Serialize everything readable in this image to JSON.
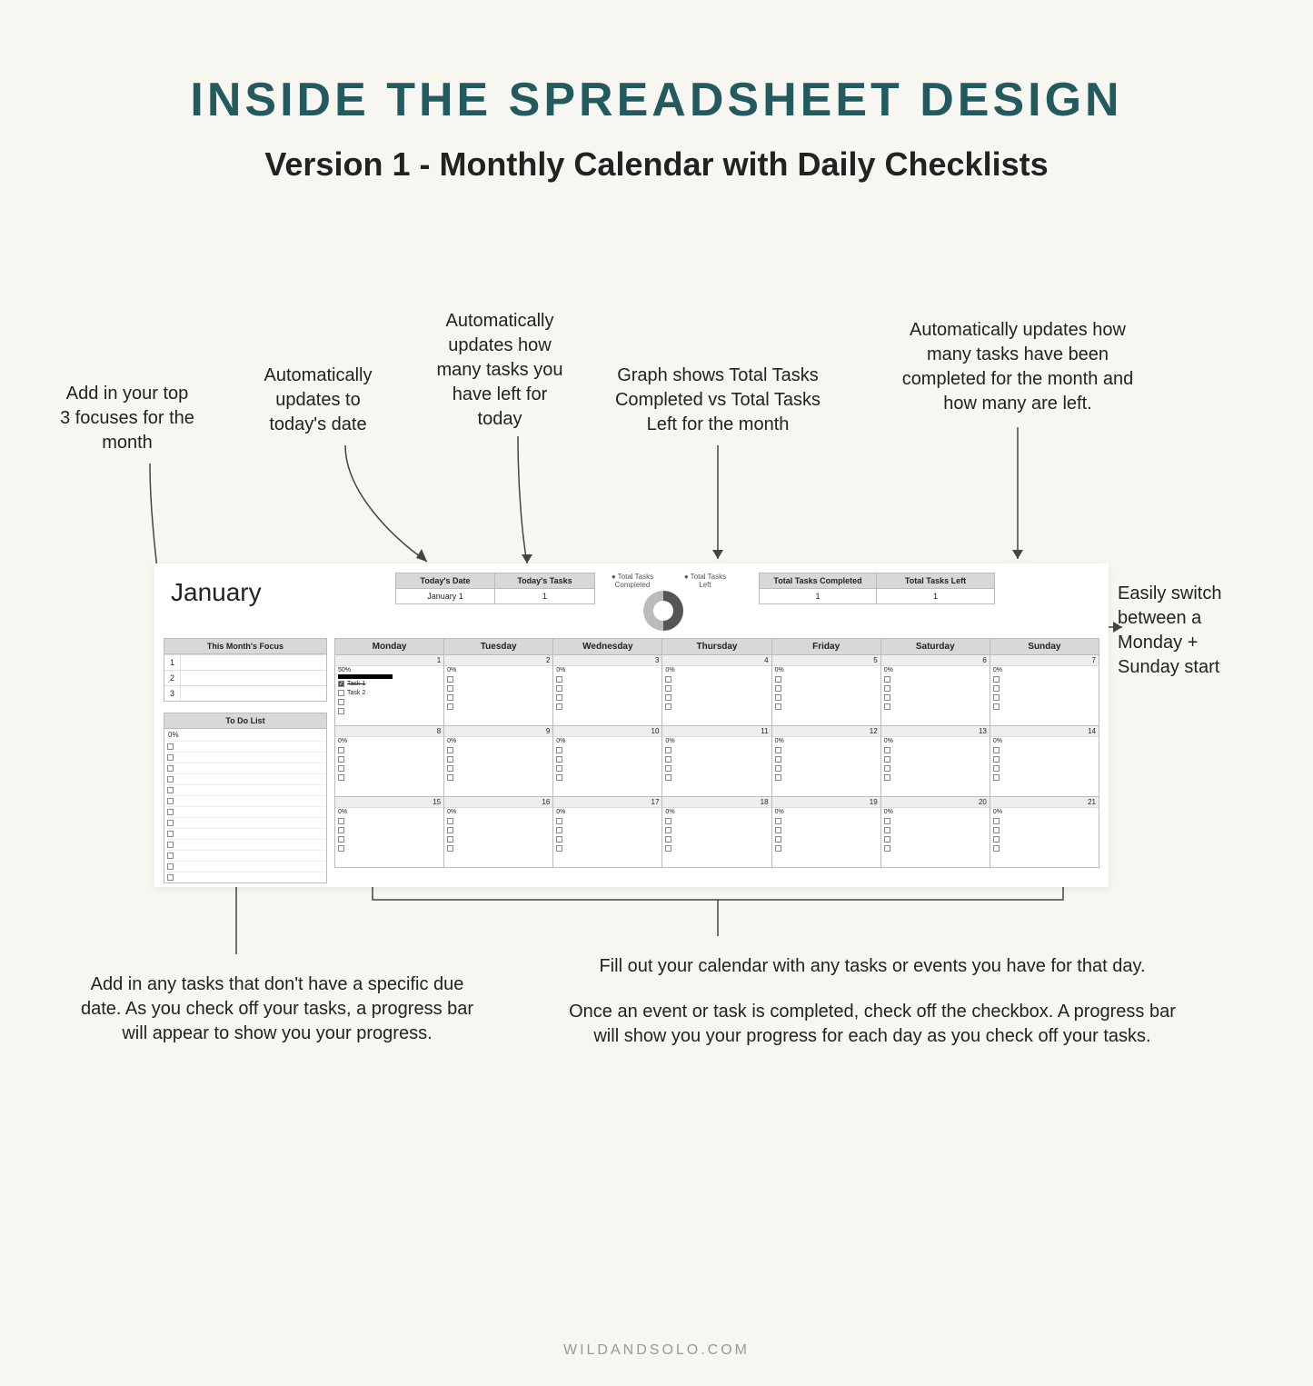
{
  "title": "INSIDE THE SPREADSHEET DESIGN",
  "subtitle": "Version 1 - Monthly Calendar with Daily Checklists",
  "footer": "WILDANDSOLO.COM",
  "annotations": {
    "focuses": "Add in your top\n3 focuses for the\nmonth",
    "date": "Automatically\nupdates to\ntoday's date",
    "tasks_today": "Automatically\nupdates how\nmany tasks you\nhave left for\ntoday",
    "graph": "Graph shows Total Tasks\nCompleted vs Total Tasks\nLeft for the month",
    "monthly_tasks": "Automatically updates how\nmany tasks have been\ncompleted for the month and\nhow many are left.",
    "switch": "Easily switch\nbetween a\nMonday +\nSunday start",
    "todo": "Add in any tasks that don't have a specific due\ndate. As you check off your tasks, a progress bar\nwill appear to show you your progress.",
    "calendar1": "Fill out your calendar with any tasks or events you have for that day.",
    "calendar2": "Once an event or task is completed, check off the checkbox. A progress bar\nwill show you your progress for each day as you check off your tasks."
  },
  "sheet": {
    "month": "January",
    "today_date_h": "Today's Date",
    "today_date_v": "January 1",
    "today_tasks_h": "Today's Tasks",
    "today_tasks_v": "1",
    "legend_completed": "Total Tasks Completed",
    "legend_left": "Total Tasks Left",
    "tot_comp_h": "Total Tasks Completed",
    "tot_comp_v": "1",
    "tot_left_h": "Total Tasks Left",
    "tot_left_v": "1",
    "focus_h": "This Month's Focus",
    "focus_rows": [
      "1",
      "2",
      "3"
    ],
    "todo_h": "To Do List",
    "todo_p": "0%",
    "weekdays": [
      "Monday",
      "Tuesday",
      "Wednesday",
      "Thursday",
      "Friday",
      "Saturday",
      "Sunday"
    ],
    "day1_task1": "Task 1",
    "day1_task2": "Task 2",
    "pct0": "0%",
    "pct50": "50%"
  },
  "chart_data": {
    "type": "pie",
    "title": "Total Tasks Completed vs Total Tasks Left",
    "series": [
      {
        "name": "Total Tasks Completed",
        "value": 1
      },
      {
        "name": "Total Tasks Left",
        "value": 1
      }
    ]
  }
}
